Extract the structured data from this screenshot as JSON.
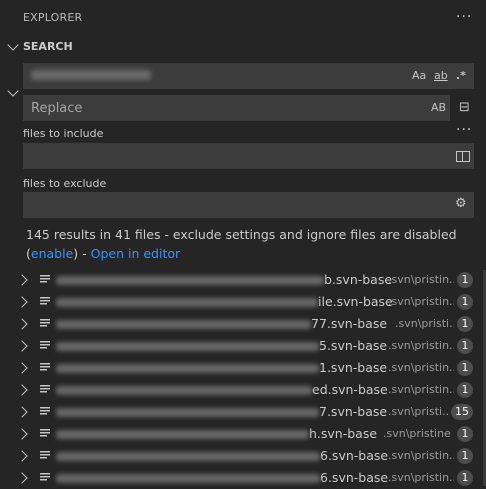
{
  "header": {
    "title": "EXPLORER",
    "more_icon": "ellipsis-icon"
  },
  "search_section": {
    "title": "SEARCH",
    "search_input": {
      "value": "",
      "match_case": "Aa",
      "whole_word": "ab",
      "regex": ".*"
    },
    "replace_input": {
      "placeholder": "Replace",
      "preserve_case": "AB"
    },
    "files_to_include": {
      "label": "files to include",
      "value": ""
    },
    "files_to_exclude": {
      "label": "files to exclude",
      "value": ""
    }
  },
  "summary": {
    "text": "145 results in 41 files - exclude settings and ignore files are disabled",
    "enable_open": "(",
    "enable_link": "enable",
    "enable_close": ")",
    "separator": " - ",
    "open_editor_link": "Open in editor"
  },
  "results": [
    {
      "name_suffix": "b.svn-base",
      "path": ".svn\\pristin...",
      "count": "1"
    },
    {
      "name_suffix": "ile.svn-base",
      "path": ".svn\\pristin...",
      "count": "1"
    },
    {
      "name_suffix": "77.svn-base",
      "path": ".svn\\pristi...",
      "count": "1"
    },
    {
      "name_suffix": "5.svn-base",
      "path": ".svn\\pristin...",
      "count": "1"
    },
    {
      "name_suffix": "1.svn-base",
      "path": ".svn\\pristin...",
      "count": "1"
    },
    {
      "name_suffix": "ed.svn-base",
      "path": ".svn\\pristin...",
      "count": "1"
    },
    {
      "name_suffix": "7.svn-base",
      "path": ".svn\\pristi...",
      "count": "15"
    },
    {
      "name_suffix": "h.svn-base",
      "path": ".svn\\pristine",
      "count": "1"
    },
    {
      "name_suffix": "6.svn-base",
      "path": ".svn\\pristin...",
      "count": "1"
    },
    {
      "name_suffix": "6.svn-base",
      "path": ".svn\\pristin...",
      "count": "1"
    }
  ]
}
